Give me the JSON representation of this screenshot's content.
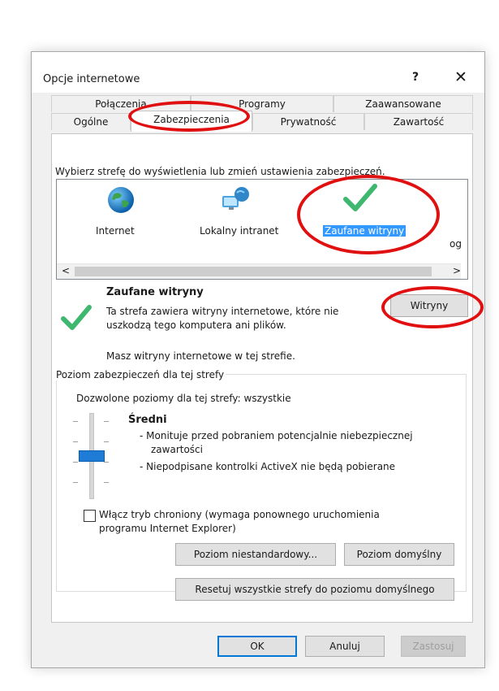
{
  "dialog": {
    "title": "Opcje internetowe",
    "help_label": "?",
    "close_label": "✕"
  },
  "tabs": {
    "row_back": [
      "Połączenia",
      "Programy",
      "Zaawansowane"
    ],
    "row_front": [
      "Ogólne",
      "Zabezpieczenia",
      "Prywatność",
      "Zawartość"
    ],
    "active": "Zabezpieczenia"
  },
  "zones": {
    "instruction": "Wybierz strefę do wyświetlenia lub zmień ustawienia zabezpieczeń.",
    "items": [
      {
        "label": "Internet",
        "icon": "globe-icon"
      },
      {
        "label": "Lokalny intranet",
        "icon": "network-monitor-icon"
      },
      {
        "label": "Zaufane witryny",
        "icon": "checkmark-icon",
        "selected": true
      }
    ],
    "overflow_text": "og",
    "scroll_left": "<",
    "scroll_right": ">"
  },
  "zone_info": {
    "title": "Zaufane witryny",
    "desc_line1": "Ta strefa zawiera witryny internetowe, które nie",
    "desc_line2": "uszkodzą tego komputera ani plików.",
    "sites_button": "Witryny",
    "has_sites": "Masz witryny internetowe w tej strefie."
  },
  "security_level": {
    "legend": "Poziom zabezpieczeń dla tej strefy",
    "allowed": "Dozwolone poziomy dla tej strefy: wszystkie",
    "level_name": "Średni",
    "line1": "- Monituje przed pobraniem potencjalnie niebezpiecznej",
    "line1b": "zawartości",
    "line2": "- Niepodpisane kontrolki ActiveX nie będą pobierane",
    "slider_level": "Średni",
    "protected_mode": "Włącz tryb chroniony (wymaga ponownego uruchomienia",
    "protected_mode_2": "programu Internet Explorer)",
    "custom_button": "Poziom niestandardowy...",
    "default_button": "Poziom domyślny"
  },
  "reset_button": "Resetuj wszystkie strefy do poziomu domyślnego",
  "footer": {
    "ok": "OK",
    "cancel": "Anuluj",
    "apply": "Zastosuj"
  },
  "colors": {
    "highlight": "#3399ff",
    "annotation": "#e01010",
    "check": "#3fb86f"
  }
}
